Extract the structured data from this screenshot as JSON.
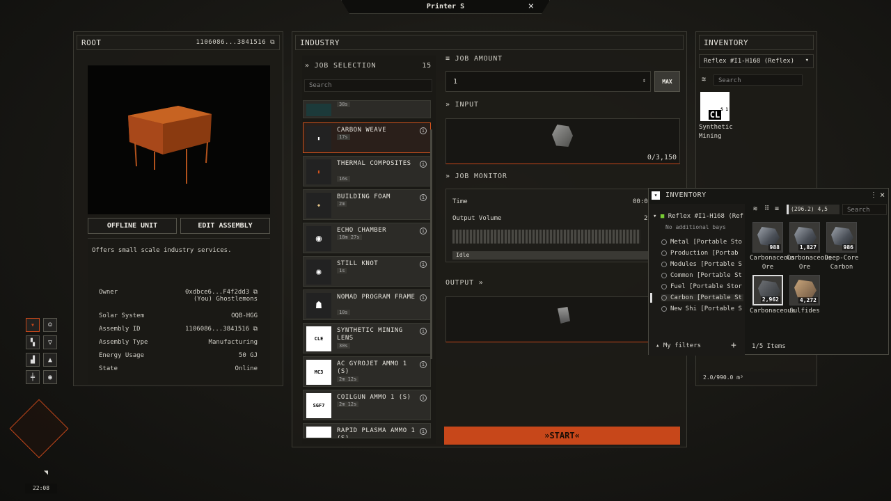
{
  "window": {
    "title": "Printer S"
  },
  "root": {
    "title": "ROOT",
    "id": "1106086...3841516",
    "offline": "OFFLINE UNIT",
    "edit": "EDIT ASSEMBLY",
    "description": "Offers small scale industry services.",
    "props": [
      {
        "k": "Owner",
        "v": "0xdbce6...F4f2dd3",
        "v2": "(You) Ghostlemons"
      },
      {
        "k": "Solar System",
        "v": "OQB-HGG"
      },
      {
        "k": "Assembly ID",
        "v": "1106086...3841516"
      },
      {
        "k": "Assembly Type",
        "v": "Manufacturing"
      },
      {
        "k": "Energy Usage",
        "v": "50 GJ"
      },
      {
        "k": "State",
        "v": "Online"
      }
    ]
  },
  "industry": {
    "title": "INDUSTRY",
    "job_selection": "JOB SELECTION",
    "job_count": "15",
    "search_placeholder": "Search",
    "items": [
      {
        "name": "CARBON WEAVE",
        "time": "17s"
      },
      {
        "name": "THERMAL COMPOSITES",
        "time": "16s"
      },
      {
        "name": "BUILDING FOAM",
        "time": "2m"
      },
      {
        "name": "ECHO CHAMBER",
        "time": "18m 27s"
      },
      {
        "name": "STILL KNOT",
        "time": "1s"
      },
      {
        "name": "NOMAD PROGRAM FRAME",
        "time": "10s"
      },
      {
        "name": "SYNTHETIC MINING LENS",
        "time": "30s",
        "icon": "CLE"
      },
      {
        "name": "AC GYROJET AMMO 1 (S)",
        "time": "2m 12s",
        "icon": "MC3"
      },
      {
        "name": "COILGUN AMMO 1 (S)",
        "time": "2m 12s",
        "icon": "SGF7"
      },
      {
        "name": "RAPID PLASMA AMMO 1 (S)",
        "time": ""
      }
    ],
    "partial_time": "38s",
    "job_amount": "JOB AMOUNT",
    "amount_value": "1",
    "max": "MAX",
    "input": "INPUT",
    "input_qty": "0/3,150",
    "job_monitor": "JOB MONITOR",
    "time_label": "Time",
    "time_value": "00:0",
    "output_volume": "Output Volume",
    "output_value": "2",
    "status": "Idle",
    "output": "OUTPUT",
    "start": "START"
  },
  "inventory": {
    "title": "INVENTORY",
    "dropdown": "Reflex #I1-H168 (Reflex)",
    "search_placeholder": "Search",
    "item_name": "Synthetic Mining",
    "item_badge": "CL",
    "item_badge_sub": "S 1",
    "capacity": "2.0/990.0 m³"
  },
  "inventory2": {
    "title": "INVENTORY",
    "ship": "Reflex #I1-H168 (Ref",
    "no_bays": "No additional bays",
    "volume": "(296.2) 4,5",
    "search_placeholder": "Search",
    "filters": [
      "Metal [Portable Sto",
      "Production [Portab",
      "Modules [Portable S",
      "Common [Portable St",
      "Fuel [Portable Stor",
      "Carbon [Portable St",
      "New Shi [Portable S"
    ],
    "my_filters": "My filters",
    "items_count": "1/5 Items",
    "cells": [
      {
        "q": "988",
        "label": "Carbonaceous Ore"
      },
      {
        "q": "1,827",
        "label": "Carbonaceous Ore"
      },
      {
        "q": "986",
        "label": "Deep-Core Carbon"
      },
      {
        "q": "2,962",
        "label": "Carbonaceous"
      },
      {
        "q": "4,272",
        "label": "Sulfides"
      }
    ]
  },
  "hud": {
    "clock": "22:08"
  }
}
